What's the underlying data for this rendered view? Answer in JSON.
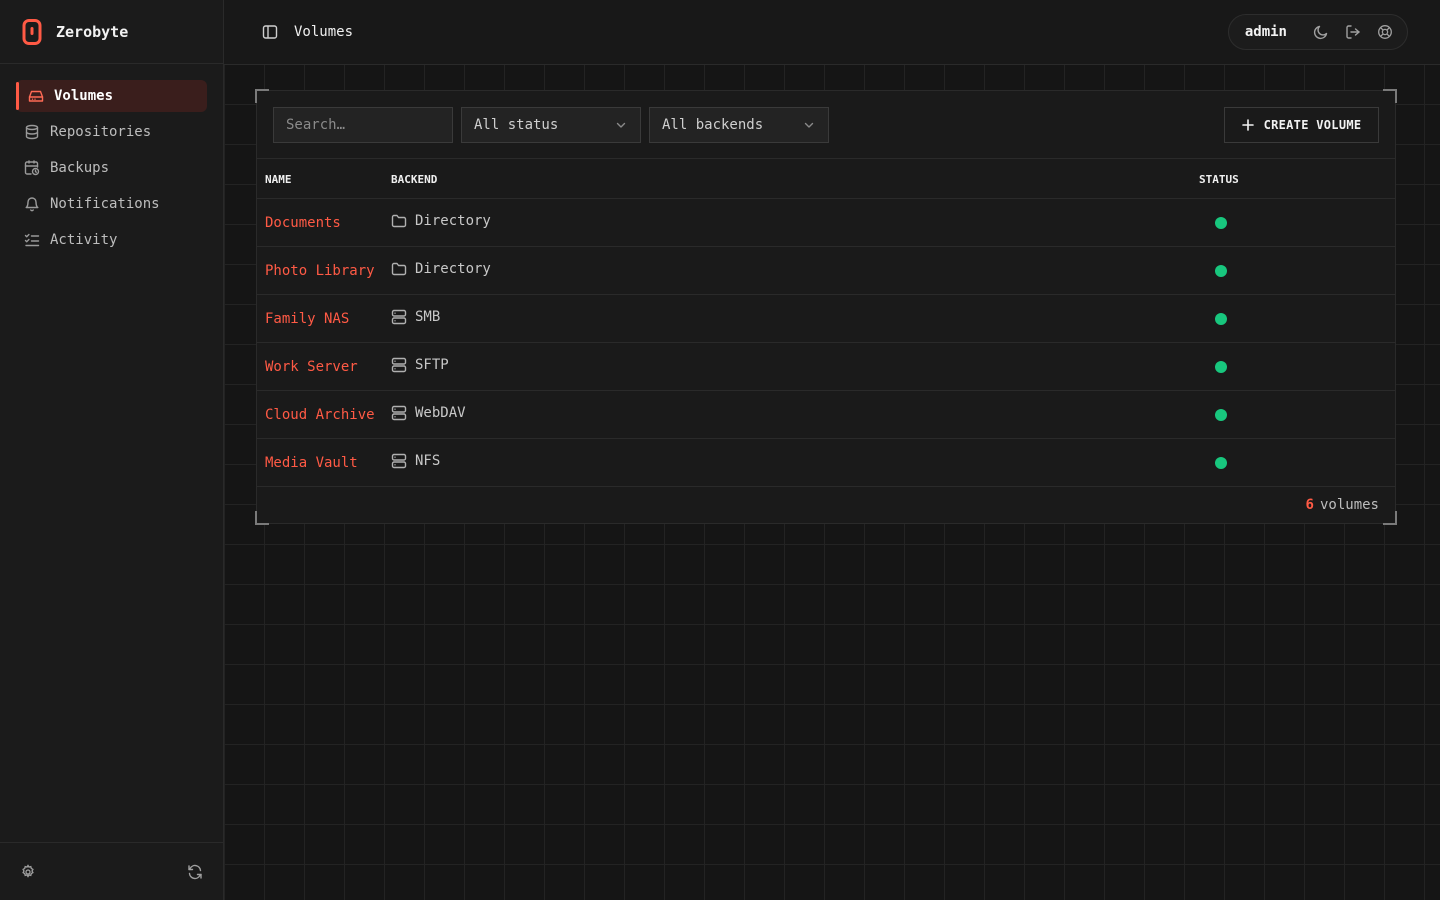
{
  "app": {
    "name": "Zerobyte",
    "accent": "#ff5a45"
  },
  "sidebar": {
    "items": [
      {
        "label": "Volumes",
        "icon": "hard-drive-icon",
        "active": true
      },
      {
        "label": "Repositories",
        "icon": "database-icon",
        "active": false
      },
      {
        "label": "Backups",
        "icon": "calendar-clock-icon",
        "active": false
      },
      {
        "label": "Notifications",
        "icon": "bell-icon",
        "active": false
      },
      {
        "label": "Activity",
        "icon": "list-checks-icon",
        "active": false
      }
    ],
    "footer_icons": [
      "settings-icon",
      "refresh-icon"
    ]
  },
  "header": {
    "title": "Volumes",
    "user": "admin",
    "icons": [
      "moon-icon",
      "logout-icon",
      "help-icon"
    ]
  },
  "toolbar": {
    "search_placeholder": "Search…",
    "status_filter": "All status",
    "backend_filter": "All backends",
    "create_label": "CREATE VOLUME"
  },
  "table": {
    "columns": {
      "name": "NAME",
      "backend": "BACKEND",
      "status": "STATUS"
    },
    "rows": [
      {
        "name": "Documents",
        "backend": "Directory",
        "backend_icon": "folder-icon",
        "status_color": "#18c77e"
      },
      {
        "name": "Photo Library",
        "backend": "Directory",
        "backend_icon": "folder-icon",
        "status_color": "#18c77e"
      },
      {
        "name": "Family NAS",
        "backend": "SMB",
        "backend_icon": "server-icon",
        "status_color": "#18c77e"
      },
      {
        "name": "Work Server",
        "backend": "SFTP",
        "backend_icon": "server-icon",
        "status_color": "#18c77e"
      },
      {
        "name": "Cloud Archive",
        "backend": "WebDAV",
        "backend_icon": "server-icon",
        "status_color": "#18c77e"
      },
      {
        "name": "Media Vault",
        "backend": "NFS",
        "backend_icon": "server-icon",
        "status_color": "#18c77e"
      }
    ]
  },
  "footer": {
    "count": "6",
    "count_label": "volumes"
  }
}
